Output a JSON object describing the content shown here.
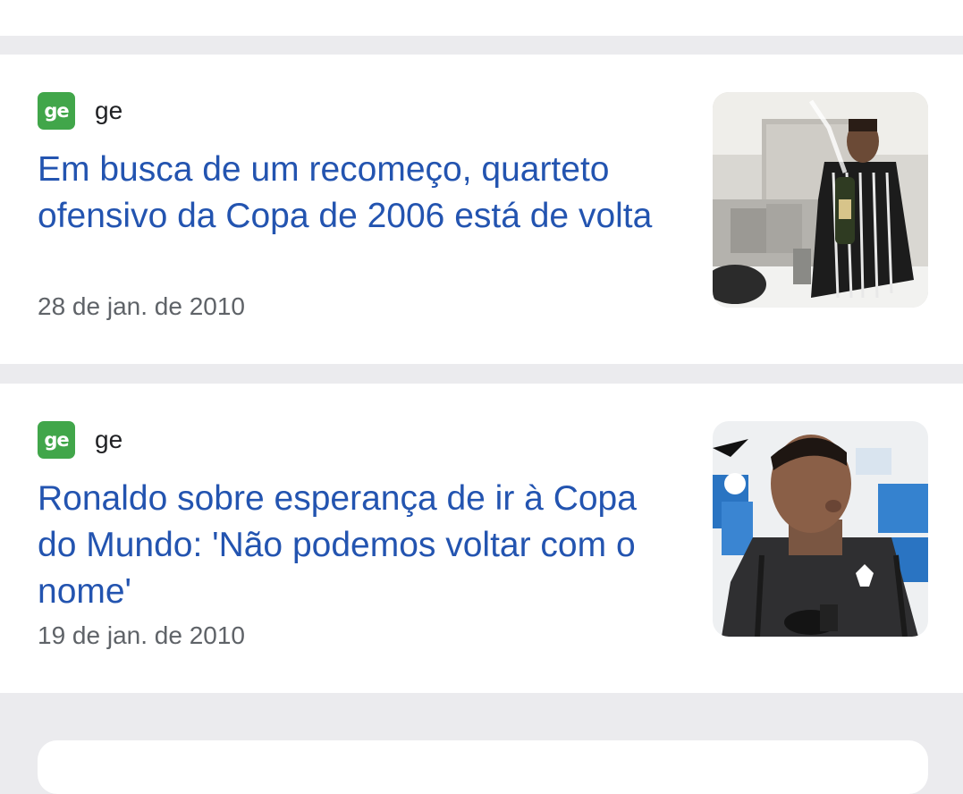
{
  "articles": [
    {
      "source": {
        "logo_text": "ge",
        "name": "ge"
      },
      "headline": "Em busca de um recomeço, quarteto ofensivo da Copa de 2006 está de volta",
      "date": "28 de jan. de 2010"
    },
    {
      "source": {
        "logo_text": "ge",
        "name": "ge"
      },
      "headline": "Ronaldo sobre esperança de ir à Copa do Mundo: 'Não podemos voltar com o nome'",
      "date": "19 de jan. de 2010"
    }
  ],
  "colors": {
    "headline": "#2354b0",
    "date": "#5f6368",
    "logo_bg": "#41a64a",
    "separator": "#ebebee"
  }
}
